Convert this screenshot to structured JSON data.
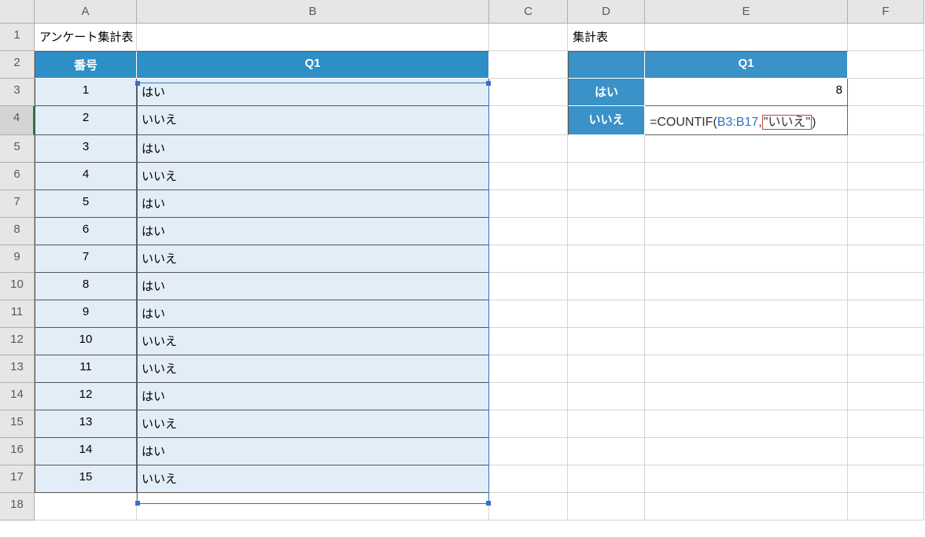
{
  "columns": [
    "A",
    "B",
    "C",
    "D",
    "E",
    "F"
  ],
  "row_count": 18,
  "active_row": 4,
  "titles": {
    "survey": "アンケート集計表",
    "summary": "集計表"
  },
  "survey_headers": {
    "number": "番号",
    "q1": "Q1"
  },
  "survey_rows": [
    {
      "num": "1",
      "q1": "はい"
    },
    {
      "num": "2",
      "q1": "いいえ"
    },
    {
      "num": "3",
      "q1": "はい"
    },
    {
      "num": "4",
      "q1": "いいえ"
    },
    {
      "num": "5",
      "q1": "はい"
    },
    {
      "num": "6",
      "q1": "はい"
    },
    {
      "num": "7",
      "q1": "いいえ"
    },
    {
      "num": "8",
      "q1": "はい"
    },
    {
      "num": "9",
      "q1": "はい"
    },
    {
      "num": "10",
      "q1": "いいえ"
    },
    {
      "num": "11",
      "q1": "いいえ"
    },
    {
      "num": "12",
      "q1": "はい"
    },
    {
      "num": "13",
      "q1": "いいえ"
    },
    {
      "num": "14",
      "q1": "はい"
    },
    {
      "num": "15",
      "q1": "いいえ"
    }
  ],
  "summary_header": {
    "q1": "Q1"
  },
  "summary_rows": {
    "yes_label": "はい",
    "yes_value": "8",
    "no_label": "いいえ",
    "no_formula_prefix": "=COUNTIF(",
    "no_formula_ref": "B3:B17",
    "no_formula_comma": ",",
    "no_formula_literal": "\"いいえ\"",
    "no_formula_suffix": ")"
  }
}
